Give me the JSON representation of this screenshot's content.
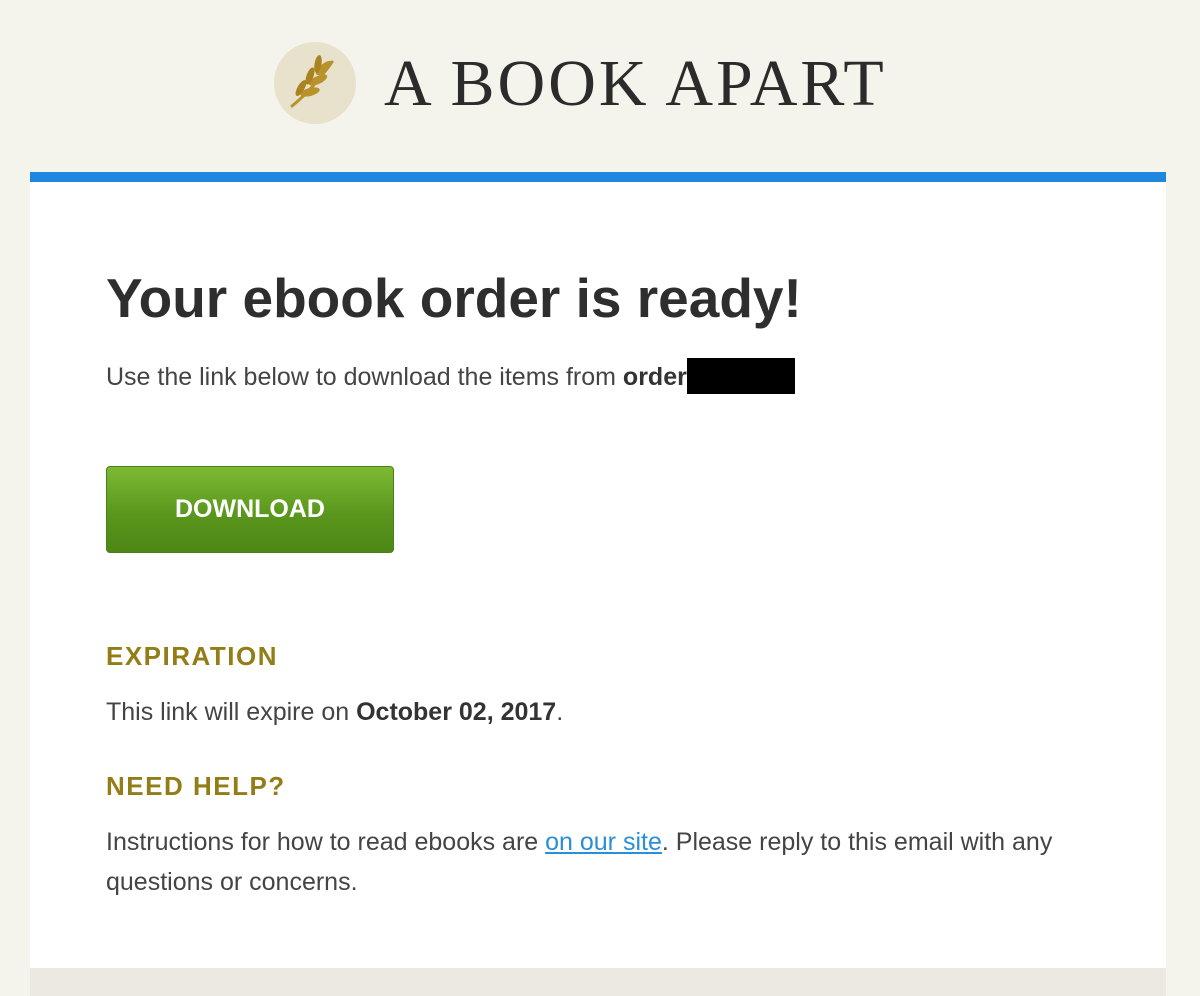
{
  "header": {
    "brand_name": "A BOOK APART",
    "logo_icon": "laurel-branch-icon"
  },
  "main": {
    "title": "Your ebook order is ready!",
    "intro_text": "Use the link below to download the items from ",
    "order_label": "order",
    "download_button_label": "DOWNLOAD",
    "expiration": {
      "heading": "EXPIRATION",
      "text_before": "This link will expire on ",
      "date": "October 02, 2017",
      "text_after": "."
    },
    "help": {
      "heading": "NEED HELP?",
      "text_before": "Instructions for how to read ebooks are ",
      "link_text": "on our site",
      "text_after": ". Please reply to this email with any questions or concerns."
    }
  },
  "colors": {
    "background": "#f4f3ec",
    "accent_bar": "#1e88e0",
    "button_green": "#5a971d",
    "heading_gold": "#937d17",
    "link_blue": "#2a8fd6"
  }
}
